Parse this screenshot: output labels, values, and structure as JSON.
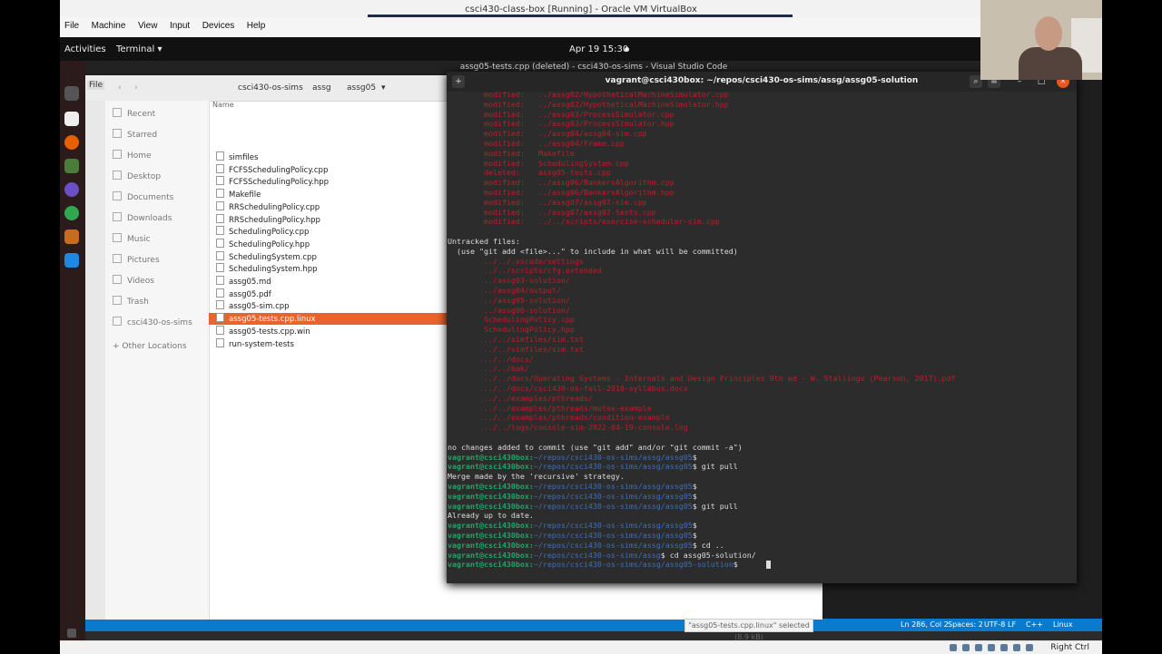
{
  "host": {
    "title": "csci430-class-box [Running] - Oracle VM VirtualBox",
    "menu": [
      "File",
      "Machine",
      "View",
      "Input",
      "Devices",
      "Help"
    ],
    "right_ctrl": "Right Ctrl"
  },
  "topbar": {
    "activities": "Activities",
    "app": "Terminal ▾",
    "clock": "Apr 19  15:30"
  },
  "vscode": {
    "title": "assg05-tests.cpp (deleted) - csci430-os-sims - Visual Studio Code",
    "status_right": [
      "Ln 286, Col 2",
      "Spaces: 2",
      "UTF-8",
      "LF",
      "C++",
      "Linux"
    ]
  },
  "files": {
    "menu_label": "File",
    "breadcrumb": [
      "csci430-os-sims",
      "assg",
      "assg05"
    ],
    "column_name": "Name",
    "sidebar": [
      "Recent",
      "Starred",
      "Home",
      "Desktop",
      "Documents",
      "Downloads",
      "Music",
      "Pictures",
      "Videos",
      "Trash",
      "csci430-os-sims",
      "+  Other Locations"
    ],
    "rows": [
      "simfiles",
      "FCFSSchedulingPolicy.cpp",
      "FCFSSchedulingPolicy.hpp",
      "Makefile",
      "RRSchedulingPolicy.cpp",
      "RRSchedulingPolicy.hpp",
      "SchedulingPolicy.cpp",
      "SchedulingPolicy.hpp",
      "SchedulingSystem.cpp",
      "SchedulingSystem.hpp",
      "assg05.md",
      "assg05.pdf",
      "assg05-sim.cpp",
      "assg05-tests.cpp.linux",
      "assg05-tests.cpp.win",
      "run-system-tests"
    ],
    "selected_index": 13,
    "status": "\"assg05-tests.cpp.linux\" selected (8.9 kB)"
  },
  "terminal": {
    "title": "vagrant@csci430box: ~/repos/csci430-os-sims/assg/assg05-solution",
    "modified_lines": [
      "        modified:   ../assg02/HypotheticalMachineSimulator.cpp",
      "        modified:   ../assg02/HypotheticalMachineSimulator.hpp",
      "        modified:   ../assg03/ProcessSimulator.cpp",
      "        modified:   ../assg03/ProcessSimulator.hpp",
      "        modified:   ../assg04/assg04-sim.cpp",
      "        modified:   ../assg04/Frame.cpp",
      "        modified:   Makefile",
      "        modified:   SchedulingSystem.cpp",
      "        deleted:    assg05-tests.cpp",
      "        modified:   ../assg06/BankersAlgorithm.cpp",
      "        modified:   ../assg06/BankersAlgorithm.hpp",
      "        modified:   ../assg07/assg07-sim.cpp",
      "        modified:   ../assg07/assg07-tests.cpp",
      "        modified:   ../../scripts/exercise-scheduler-sim.cpp"
    ],
    "untracked_header": "Untracked files:",
    "untracked_hint": "  (use \"git add <file>...\" to include in what will be committed)",
    "untracked_lines": [
      "        ../../.vscode/settings",
      "        ../../scripts/cfg.extended",
      "        ../assg03-solution/",
      "        ../assg04/output/",
      "        ../assg05-solution/",
      "        ../assg06-solution/",
      "        SchedulingPolicy.cpp",
      "        SchedulingPolicy.hpp",
      "        ../../simfiles/sim.txt",
      "        ../../simfiles/sim.txt",
      "        ../../docs/",
      "        ../../bak/",
      "        ../../docs/Operating Systems - Internals and Design Principles 9th ed - W. Stallings (Pearson, 2017).pdf",
      "        ../../docs/csci430-os-fall-2018-syllabus.docx",
      "        ../../examples/pthreads/",
      "        ../../examples/pthreads/mutex-example",
      "        ../../examples/pthreads/condition-example",
      "        ../../logs/console-sim-2022-04-19-console.log"
    ],
    "no_changes": "no changes added to commit (use \"git add\" and/or \"git commit -a\")",
    "user_host": "vagrant@csci430box",
    "path_assg05": "~/repos/csci430-os-sims/assg/assg05",
    "path_assg": "~/repos/csci430-os-sims/assg",
    "path_solution": "~/repos/csci430-os-sims/assg/assg05-solution",
    "git_pull": "git pull",
    "merge_msg": "Merge made by the 'recursive' strategy.",
    "up_to_date": "Already up to date.",
    "cd_up": "cd ..",
    "cd_solution": "cd assg05-solution/"
  }
}
